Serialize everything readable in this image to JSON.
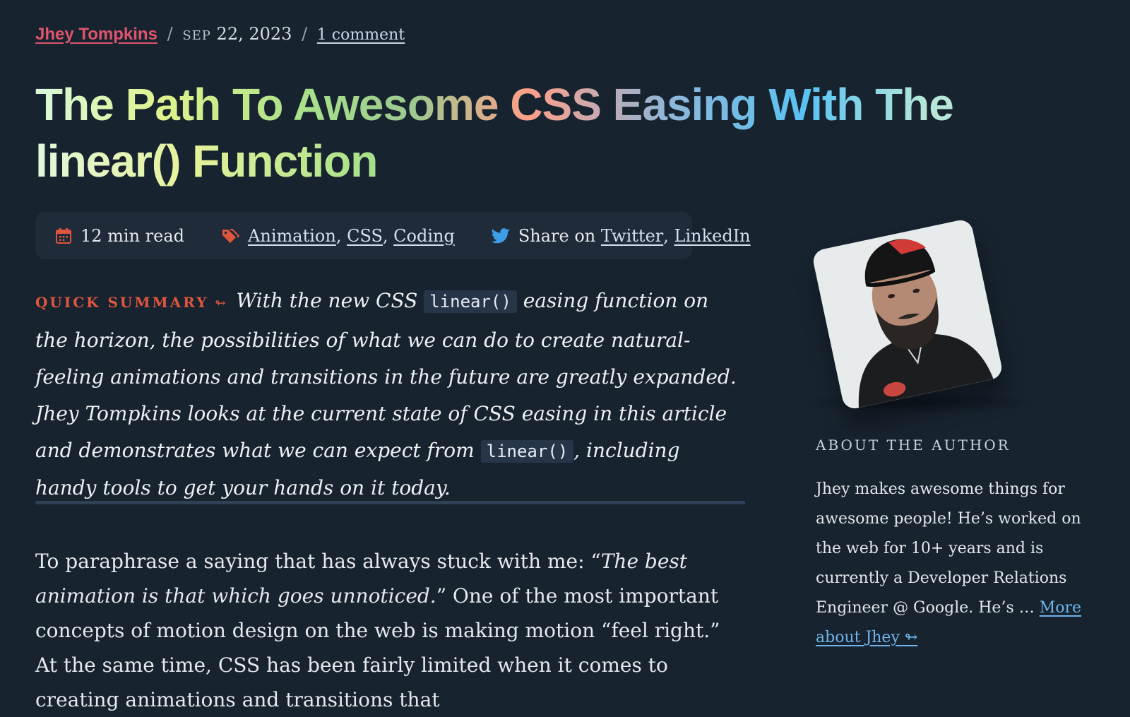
{
  "meta": {
    "author": "Jhey Tompkins",
    "separator": "/",
    "month": "Sep",
    "date": "22, 2023",
    "comments": "1 comment"
  },
  "article": {
    "title_line1": "The Path To Awesome CSS Easing With The",
    "title_line2": "linear() Function"
  },
  "info_bar": {
    "read_time": "12 min read",
    "tags": [
      "Animation",
      "CSS",
      "Coding"
    ],
    "share_label": "Share on",
    "share_links": [
      "Twitter",
      "LinkedIn"
    ],
    "icons": {
      "calendar": "calendar-icon",
      "tag": "tag-icon",
      "twitter": "twitter-icon"
    },
    "icon_color": "#e0553f",
    "twitter_color": "#3d9ee8"
  },
  "summary": {
    "label": "Quick Summary",
    "arrow": "↬",
    "text_1": "With the new CSS",
    "code_1": "linear()",
    "text_2": "easing function on the horizon, the possibilities of what we can do to create natural-feeling animations and transitions in the future are greatly expanded. Jhey Tompkins looks at the current state of CSS easing in this article and demonstrates what we can expect from",
    "code_2": "linear()",
    "text_3": ", including handy tools to get your hands on it today."
  },
  "body": {
    "text_1": "To paraphrase a saying that has always stuck with me: “",
    "quote": "The best animation is that which goes unnoticed.",
    "text_2": "” One of the most important concepts of motion design on the web is making motion “feel right.” At the same time, CSS has been fairly limited when it comes to creating animations and transitions that"
  },
  "sidebar": {
    "about_heading": "About The Author",
    "about_text": "Jhey makes awesome things for awesome people! He’s worked on the web for 10+ years and is currently a Developer Relations Engineer @ Google. He’s …",
    "more_link": "More about Jhey ↬"
  },
  "colors": {
    "background": "#17232f",
    "accent_red": "#e0553f",
    "author_pink": "#e0546b",
    "link_blue": "#6fb4ea"
  }
}
